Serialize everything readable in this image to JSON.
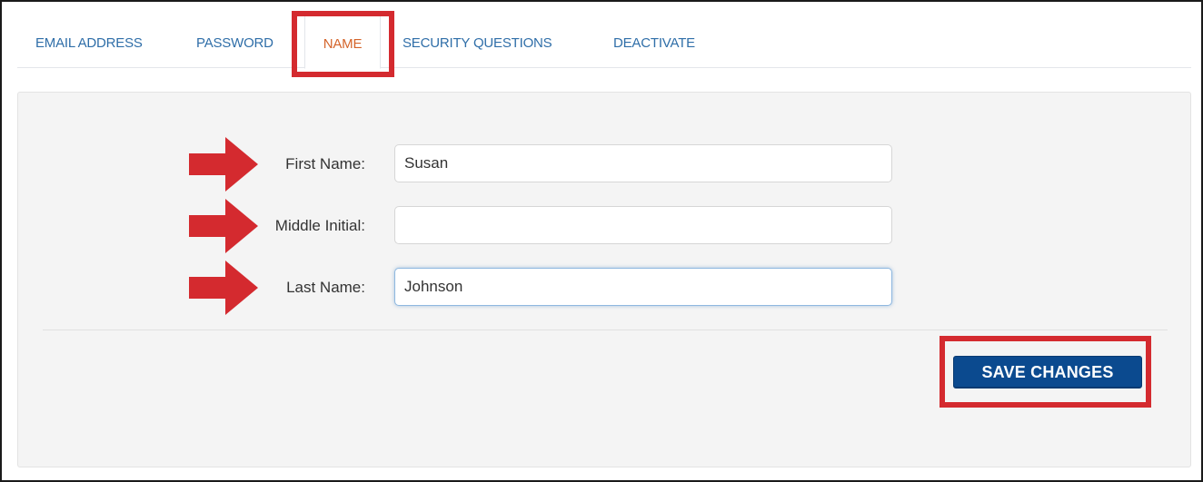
{
  "tabs": [
    {
      "label": "EMAIL ADDRESS",
      "active": false
    },
    {
      "label": "PASSWORD",
      "active": false
    },
    {
      "label": "NAME",
      "active": true
    },
    {
      "label": "SECURITY QUESTIONS",
      "active": false
    },
    {
      "label": "DEACTIVATE",
      "active": false
    }
  ],
  "form": {
    "first_name": {
      "label": "First Name:",
      "value": "Susan"
    },
    "middle_initial": {
      "label": "Middle Initial:",
      "value": ""
    },
    "last_name": {
      "label": "Last Name:",
      "value": "Johnson",
      "focused": true
    }
  },
  "save_button": {
    "label": "SAVE CHANGES"
  },
  "colors": {
    "tab_link": "#2f6ea8",
    "tab_active": "#d4642a",
    "highlight": "#d42a2f",
    "button_bg": "#0b4a8f",
    "panel_bg": "#f4f4f4"
  },
  "icons": {
    "annotation_arrow": "right-arrow-icon"
  }
}
